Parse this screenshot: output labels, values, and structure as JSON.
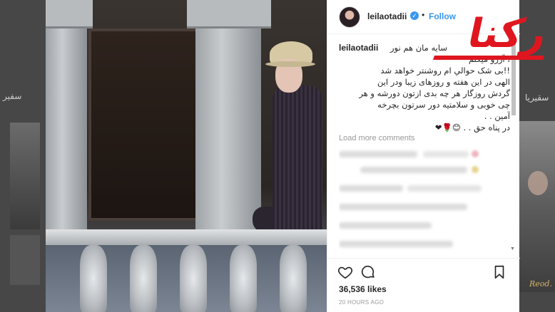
{
  "background": {
    "left_text": "سفیر",
    "right_text": "سقیریا",
    "right_signature": "Reod."
  },
  "post": {
    "username": "leilaotadii",
    "verified": true,
    "follow_label": "Follow",
    "caption": {
      "username": "leilaotadii",
      "lines": [
        "سایه مان هم نور",
        "، آرزو میکنم",
        "!!بی شک حوالي ام روشنتر خواهد شد",
        "الهی در این هفته و روزهای زیبا ودر این",
        "گردش روزگار هر چه بدی ازتون دورشه و هر",
        "چی خوبی و سلامتیه دور سرتون بچرخه",
        "آمین . .",
        "در پناه حق . . 😊🌹❤"
      ]
    },
    "load_more_label": "Load more comments",
    "likes": "36,536 likes",
    "timestamp": "20 HOURS AGO"
  },
  "icons": {
    "like": "heart-icon",
    "comment": "comment-icon",
    "save": "bookmark-icon"
  },
  "colors": {
    "link_blue": "#3897f0",
    "logo_red": "#e0161f",
    "text": "#262626"
  },
  "watermark": {
    "text": "رکنا"
  }
}
